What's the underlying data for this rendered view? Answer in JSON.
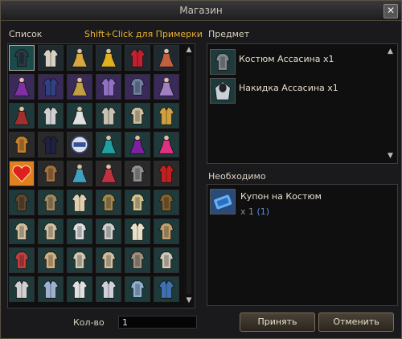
{
  "window": {
    "title": "Магазин",
    "close_glyph": "✕"
  },
  "list": {
    "header": "Список",
    "hint": "Shift+Click для Примерки",
    "hint_color": "#e8b030",
    "grid_rows": [
      [
        {
          "icon": "armor-icon",
          "c": "#2a3a44",
          "bg": "#1a4a4a",
          "sel": true
        },
        {
          "icon": "coat-icon",
          "c": "#d8d0c0",
          "bg": "#1f2a30"
        },
        {
          "icon": "dress-icon",
          "c": "#d8a840",
          "bg": "#1f2a30"
        },
        {
          "icon": "dress-icon",
          "c": "#e0b020",
          "bg": "#1f2a30"
        },
        {
          "icon": "coat-icon",
          "c": "#c02030",
          "bg": "#1f2a30"
        },
        {
          "icon": "dress-icon",
          "c": "#c06040",
          "bg": "#1f2a30"
        }
      ],
      [
        {
          "icon": "dress-icon",
          "c": "#8030a0",
          "bg": "#3a2a5a"
        },
        {
          "icon": "coat-icon",
          "c": "#304080",
          "bg": "#3a2a5a"
        },
        {
          "icon": "dress-icon",
          "c": "#c0a040",
          "bg": "#3a2a5a"
        },
        {
          "icon": "coat-icon",
          "c": "#9070c0",
          "bg": "#3a2a5a"
        },
        {
          "icon": "armor-icon",
          "c": "#7080a0",
          "bg": "#3a2a5a"
        },
        {
          "icon": "dress-icon",
          "c": "#a080c0",
          "bg": "#3a2a5a"
        }
      ],
      [
        {
          "icon": "dress-icon",
          "c": "#a03030",
          "bg": "#1f3a3a"
        },
        {
          "icon": "coat-icon",
          "c": "#d0d0d0",
          "bg": "#1f3a3a"
        },
        {
          "icon": "dress-icon",
          "c": "#e0e0e0",
          "bg": "#1f3a3a"
        },
        {
          "icon": "coat-icon",
          "c": "#c8c0b0",
          "bg": "#1f3a3a"
        },
        {
          "icon": "armor-icon",
          "c": "#d0c0a0",
          "bg": "#1f3a3a"
        },
        {
          "icon": "coat-icon",
          "c": "#d0a040",
          "bg": "#1f3a3a"
        }
      ],
      [
        {
          "icon": "armor-icon",
          "c": "#c08030",
          "bg": "#2a2a2a"
        },
        {
          "icon": "coat-icon",
          "c": "#202040",
          "bg": "#2a2a2a"
        },
        {
          "icon": "badge-icon",
          "c": "#8090c0",
          "bg": "#2a2a2a"
        },
        {
          "icon": "dress-icon",
          "c": "#20a0a0",
          "bg": "#1f3a3a"
        },
        {
          "icon": "dress-icon",
          "c": "#8020a0",
          "bg": "#1f3a3a"
        },
        {
          "icon": "dress-icon",
          "c": "#e03080",
          "bg": "#1f3a3a"
        }
      ],
      [
        {
          "icon": "heart-icon",
          "c": "#e02020",
          "bg": "#e08020"
        },
        {
          "icon": "armor-icon",
          "c": "#a07040",
          "bg": "#2a2a2a"
        },
        {
          "icon": "dress-icon",
          "c": "#40a0c0",
          "bg": "#2a2a2a"
        },
        {
          "icon": "dress-icon",
          "c": "#c03040",
          "bg": "#2a2a2a"
        },
        {
          "icon": "armor-icon",
          "c": "#909090",
          "bg": "#2a2a2a"
        },
        {
          "icon": "coat-icon",
          "c": "#c02020",
          "bg": "#2a2a2a"
        }
      ],
      [
        {
          "icon": "armor-icon",
          "c": "#604830",
          "bg": "#1f3a3a"
        },
        {
          "icon": "armor-icon",
          "c": "#a08860",
          "bg": "#1f3a3a"
        },
        {
          "icon": "coat-icon",
          "c": "#e0d0b0",
          "bg": "#1f3a3a"
        },
        {
          "icon": "armor-icon",
          "c": "#a08850",
          "bg": "#1f3a3a"
        },
        {
          "icon": "armor-icon",
          "c": "#d0c090",
          "bg": "#1f3a3a"
        },
        {
          "icon": "armor-icon",
          "c": "#806030",
          "bg": "#1f3a3a"
        }
      ],
      [
        {
          "icon": "armor-icon",
          "c": "#d0c0a0",
          "bg": "#1f3a3a"
        },
        {
          "icon": "armor-icon",
          "c": "#d0c0a0",
          "bg": "#1f3a3a"
        },
        {
          "icon": "armor-icon",
          "c": "#e0e0e0",
          "bg": "#1f3a3a"
        },
        {
          "icon": "armor-icon",
          "c": "#d0d0d0",
          "bg": "#1f3a3a"
        },
        {
          "icon": "coat-icon",
          "c": "#e8e0c8",
          "bg": "#1f3a3a"
        },
        {
          "icon": "armor-icon",
          "c": "#c0a070",
          "bg": "#1f3a3a"
        }
      ],
      [
        {
          "icon": "armor-icon",
          "c": "#c04040",
          "bg": "#1f3a3a"
        },
        {
          "icon": "armor-icon",
          "c": "#d0b080",
          "bg": "#1f3a3a"
        },
        {
          "icon": "armor-icon",
          "c": "#d0c8b0",
          "bg": "#1f3a3a"
        },
        {
          "icon": "armor-icon",
          "c": "#d0c0a0",
          "bg": "#1f3a3a"
        },
        {
          "icon": "armor-icon",
          "c": "#a09080",
          "bg": "#1f3a3a"
        },
        {
          "icon": "armor-icon",
          "c": "#d0c8b8",
          "bg": "#1f3a3a"
        }
      ],
      [
        {
          "icon": "coat-icon",
          "c": "#d0d0d0",
          "bg": "#1f3a3a"
        },
        {
          "icon": "coat-icon",
          "c": "#a0b0d0",
          "bg": "#1f3a3a"
        },
        {
          "icon": "coat-icon",
          "c": "#e0e0e0",
          "bg": "#1f3a3a"
        },
        {
          "icon": "coat-icon",
          "c": "#d0d0d8",
          "bg": "#1f3a3a"
        },
        {
          "icon": "armor-icon",
          "c": "#90b0d0",
          "bg": "#1f3a3a"
        },
        {
          "icon": "coat-icon",
          "c": "#4070b0",
          "bg": "#1f3a3a"
        }
      ]
    ]
  },
  "product": {
    "header": "Предмет",
    "items": [
      {
        "name": "Костюм Ассасина x1",
        "icon": "armor-icon",
        "color": "#808890"
      },
      {
        "name": "Накидка Ассасина x1",
        "icon": "cloak-icon",
        "color": "#c8d0d8"
      }
    ]
  },
  "required": {
    "header": "Необходимо",
    "item": {
      "name": "Купон на Костюм",
      "icon": "coupon-icon",
      "color": "#3a7ac8",
      "qty": "x 1",
      "owned": "(1)",
      "owned_color": "#5a8ae0"
    }
  },
  "footer": {
    "qty_label": "Кол-во",
    "qty_value": "1",
    "accept_label": "Принять",
    "cancel_label": "Отменить"
  }
}
